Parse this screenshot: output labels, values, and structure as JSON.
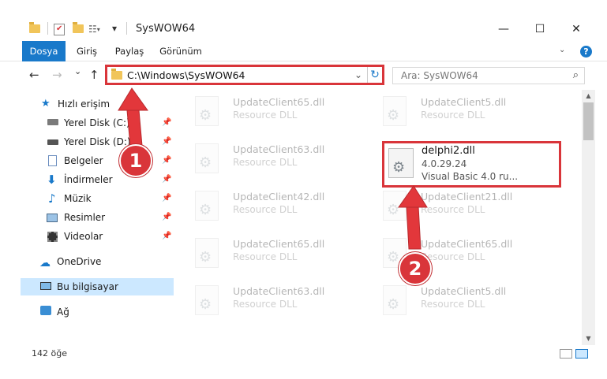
{
  "window": {
    "title": "SysWOW64",
    "minimize_glyph": "—",
    "maximize_glyph": "☐",
    "close_glyph": "✕"
  },
  "quick_access_toolbar": {
    "dropdown_glyph": "▾"
  },
  "ribbon": {
    "tabs": [
      "Dosya",
      "Giriş",
      "Paylaş",
      "Görünüm"
    ],
    "expand_glyph": "⌄",
    "help_label": "?"
  },
  "navigation": {
    "back_glyph": "←",
    "forward_glyph": "→",
    "recent_glyph": "⌄",
    "up_glyph": "↑",
    "address_path": "C:\\Windows\\SysWOW64",
    "address_dropdown_glyph": "⌄",
    "refresh_glyph": "↻",
    "search_placeholder": "Ara: SysWOW64",
    "search_glyph": "⌕"
  },
  "sidebar": {
    "items": [
      {
        "label": "Hızlı erişim",
        "icon": "star-icon"
      },
      {
        "label": "Yerel Disk (C:)",
        "icon": "drive-icon",
        "pinned": true
      },
      {
        "label": "Yerel Disk (D:)",
        "icon": "drive-icon",
        "pinned": true
      },
      {
        "label": "Belgeler",
        "icon": "document-icon",
        "pinned": true
      },
      {
        "label": "İndirmeler",
        "icon": "download-icon",
        "pinned": true
      },
      {
        "label": "Müzik",
        "icon": "music-icon",
        "pinned": true
      },
      {
        "label": "Resimler",
        "icon": "pictures-icon",
        "pinned": true
      },
      {
        "label": "Videolar",
        "icon": "video-icon",
        "pinned": true
      },
      {
        "label": "OneDrive",
        "icon": "cloud-icon"
      },
      {
        "label": "Bu bilgisayar",
        "icon": "computer-icon",
        "selected": true
      },
      {
        "label": "Ağ",
        "icon": "network-icon"
      }
    ],
    "pin_glyph": "📌"
  },
  "files": {
    "left_column": [
      {
        "name": "UpdateClient65.dll",
        "description": "Resource DLL"
      },
      {
        "name": "UpdateClient63.dll",
        "description": "Resource DLL"
      },
      {
        "name": "UpdateClient42.dll",
        "description": "Resource DLL"
      },
      {
        "name": "UpdateClient65.dll",
        "description": "Resource DLL"
      },
      {
        "name": "UpdateClient63.dll",
        "description": "Resource DLL"
      }
    ],
    "right_column": [
      {
        "name": "UpdateClient5.dll",
        "description": "Resource DLL"
      },
      {
        "name": "UpdateClient21.dll",
        "description": "Resource DLL"
      },
      {
        "name": "UpdateClient65.dll",
        "description": "Resource DLL"
      },
      {
        "name": "UpdateClient5.dll",
        "description": "Resource DLL"
      }
    ],
    "highlighted": {
      "name": "delphi2.dll",
      "version": "4.0.29.24",
      "description": "Visual Basic 4.0 ru..."
    }
  },
  "status_bar": {
    "item_count": "142 öğe"
  },
  "annotations": {
    "step1": "1",
    "step2": "2",
    "color": "#d9353a"
  }
}
